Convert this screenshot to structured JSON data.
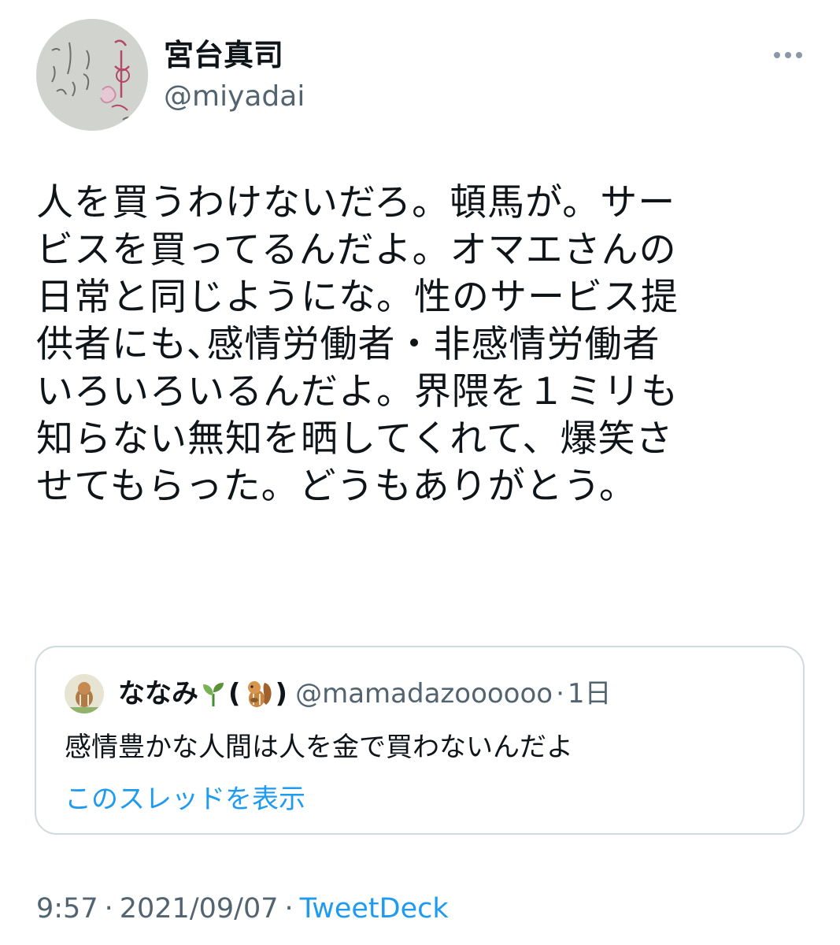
{
  "author": {
    "display_name": "宮台真司",
    "handle": "@miyadai",
    "avatar_icon": "handwritten-paper-avatar"
  },
  "more_icon": "more-horizontal-icon",
  "tweet": {
    "text": "人を買うわけないだろ。頓馬が。サー\nビスを買ってるんだよ。オマエさんの\n日常と同じようにな。性のサービス提\n供者にも､感情労働者・非感情労働者\nいろいろいるんだよ。界隈を１ミリも\n知らない無知を晒してくれて、爆笑さ\nせてもらった。どうもありがとう。"
  },
  "quote": {
    "display_name": "ななみ",
    "emoji_icons": [
      "seedling-icon",
      "chipmunk-icon"
    ],
    "paren_open": "(",
    "paren_close": ")",
    "handle": "@mamadazoooooo",
    "separator": "·",
    "time": "1日",
    "text": "感情豊かな人間は人を金で買わないんだよ",
    "thread_link": "このスレッドを表示"
  },
  "meta": {
    "time": "9:57",
    "separator": "·",
    "date": "2021/09/07",
    "source": "TweetDeck"
  },
  "colors": {
    "text": "#0f1419",
    "secondary": "#536471",
    "link": "#1d9bf0",
    "border": "#cfd9de"
  }
}
